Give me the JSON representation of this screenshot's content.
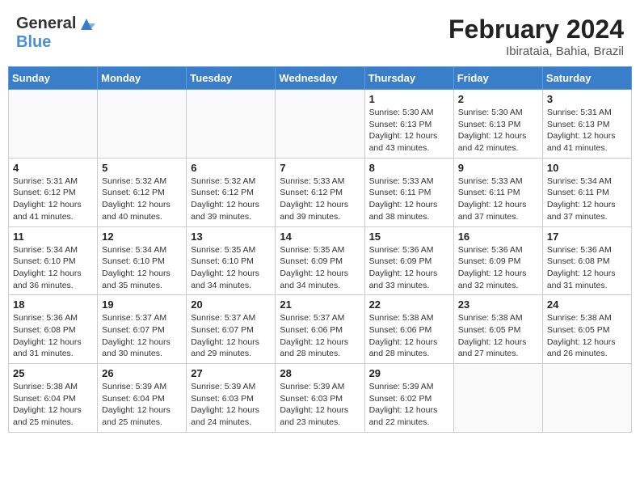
{
  "header": {
    "logo_general": "General",
    "logo_blue": "Blue",
    "month_year": "February 2024",
    "location": "Ibirataia, Bahia, Brazil"
  },
  "weekdays": [
    "Sunday",
    "Monday",
    "Tuesday",
    "Wednesday",
    "Thursday",
    "Friday",
    "Saturday"
  ],
  "weeks": [
    [
      {
        "day": "",
        "info": ""
      },
      {
        "day": "",
        "info": ""
      },
      {
        "day": "",
        "info": ""
      },
      {
        "day": "",
        "info": ""
      },
      {
        "day": "1",
        "info": "Sunrise: 5:30 AM\nSunset: 6:13 PM\nDaylight: 12 hours\nand 43 minutes."
      },
      {
        "day": "2",
        "info": "Sunrise: 5:30 AM\nSunset: 6:13 PM\nDaylight: 12 hours\nand 42 minutes."
      },
      {
        "day": "3",
        "info": "Sunrise: 5:31 AM\nSunset: 6:13 PM\nDaylight: 12 hours\nand 41 minutes."
      }
    ],
    [
      {
        "day": "4",
        "info": "Sunrise: 5:31 AM\nSunset: 6:12 PM\nDaylight: 12 hours\nand 41 minutes."
      },
      {
        "day": "5",
        "info": "Sunrise: 5:32 AM\nSunset: 6:12 PM\nDaylight: 12 hours\nand 40 minutes."
      },
      {
        "day": "6",
        "info": "Sunrise: 5:32 AM\nSunset: 6:12 PM\nDaylight: 12 hours\nand 39 minutes."
      },
      {
        "day": "7",
        "info": "Sunrise: 5:33 AM\nSunset: 6:12 PM\nDaylight: 12 hours\nand 39 minutes."
      },
      {
        "day": "8",
        "info": "Sunrise: 5:33 AM\nSunset: 6:11 PM\nDaylight: 12 hours\nand 38 minutes."
      },
      {
        "day": "9",
        "info": "Sunrise: 5:33 AM\nSunset: 6:11 PM\nDaylight: 12 hours\nand 37 minutes."
      },
      {
        "day": "10",
        "info": "Sunrise: 5:34 AM\nSunset: 6:11 PM\nDaylight: 12 hours\nand 37 minutes."
      }
    ],
    [
      {
        "day": "11",
        "info": "Sunrise: 5:34 AM\nSunset: 6:10 PM\nDaylight: 12 hours\nand 36 minutes."
      },
      {
        "day": "12",
        "info": "Sunrise: 5:34 AM\nSunset: 6:10 PM\nDaylight: 12 hours\nand 35 minutes."
      },
      {
        "day": "13",
        "info": "Sunrise: 5:35 AM\nSunset: 6:10 PM\nDaylight: 12 hours\nand 34 minutes."
      },
      {
        "day": "14",
        "info": "Sunrise: 5:35 AM\nSunset: 6:09 PM\nDaylight: 12 hours\nand 34 minutes."
      },
      {
        "day": "15",
        "info": "Sunrise: 5:36 AM\nSunset: 6:09 PM\nDaylight: 12 hours\nand 33 minutes."
      },
      {
        "day": "16",
        "info": "Sunrise: 5:36 AM\nSunset: 6:09 PM\nDaylight: 12 hours\nand 32 minutes."
      },
      {
        "day": "17",
        "info": "Sunrise: 5:36 AM\nSunset: 6:08 PM\nDaylight: 12 hours\nand 31 minutes."
      }
    ],
    [
      {
        "day": "18",
        "info": "Sunrise: 5:36 AM\nSunset: 6:08 PM\nDaylight: 12 hours\nand 31 minutes."
      },
      {
        "day": "19",
        "info": "Sunrise: 5:37 AM\nSunset: 6:07 PM\nDaylight: 12 hours\nand 30 minutes."
      },
      {
        "day": "20",
        "info": "Sunrise: 5:37 AM\nSunset: 6:07 PM\nDaylight: 12 hours\nand 29 minutes."
      },
      {
        "day": "21",
        "info": "Sunrise: 5:37 AM\nSunset: 6:06 PM\nDaylight: 12 hours\nand 28 minutes."
      },
      {
        "day": "22",
        "info": "Sunrise: 5:38 AM\nSunset: 6:06 PM\nDaylight: 12 hours\nand 28 minutes."
      },
      {
        "day": "23",
        "info": "Sunrise: 5:38 AM\nSunset: 6:05 PM\nDaylight: 12 hours\nand 27 minutes."
      },
      {
        "day": "24",
        "info": "Sunrise: 5:38 AM\nSunset: 6:05 PM\nDaylight: 12 hours\nand 26 minutes."
      }
    ],
    [
      {
        "day": "25",
        "info": "Sunrise: 5:38 AM\nSunset: 6:04 PM\nDaylight: 12 hours\nand 25 minutes."
      },
      {
        "day": "26",
        "info": "Sunrise: 5:39 AM\nSunset: 6:04 PM\nDaylight: 12 hours\nand 25 minutes."
      },
      {
        "day": "27",
        "info": "Sunrise: 5:39 AM\nSunset: 6:03 PM\nDaylight: 12 hours\nand 24 minutes."
      },
      {
        "day": "28",
        "info": "Sunrise: 5:39 AM\nSunset: 6:03 PM\nDaylight: 12 hours\nand 23 minutes."
      },
      {
        "day": "29",
        "info": "Sunrise: 5:39 AM\nSunset: 6:02 PM\nDaylight: 12 hours\nand 22 minutes."
      },
      {
        "day": "",
        "info": ""
      },
      {
        "day": "",
        "info": ""
      }
    ]
  ]
}
